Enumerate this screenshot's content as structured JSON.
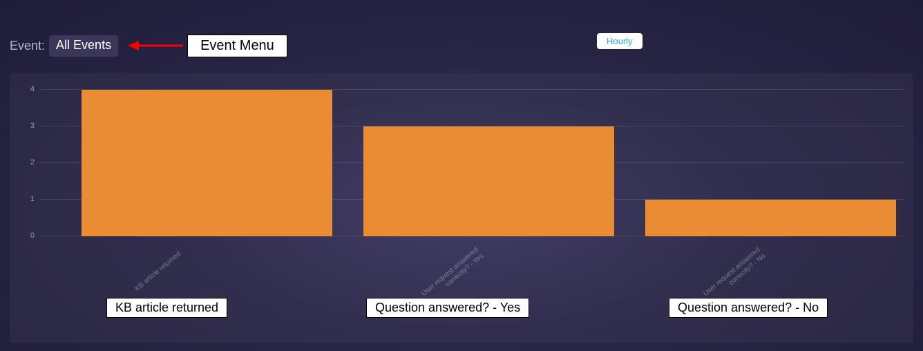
{
  "controls": {
    "event_label": "Event:",
    "event_selected": "All Events",
    "event_callout": "Event Menu",
    "hourly_label": "Hourly"
  },
  "chart_data": {
    "type": "bar",
    "categories": [
      "KB article returned",
      "User request answered\ncorrectly? - Yes",
      "User request answered\ncorrectly? - No"
    ],
    "values": [
      4,
      3,
      1
    ],
    "ylim": [
      0,
      4
    ],
    "yticks": [
      0,
      1,
      2,
      3,
      4
    ],
    "title": "",
    "xlabel": "",
    "ylabel": ""
  },
  "callouts": {
    "bars": [
      "KB article returned",
      "Question answered? - Yes",
      "Question answered? - No"
    ]
  },
  "colors": {
    "bar": "#e98c33",
    "arrow": "#ff0000",
    "hourly_text": "#29a6e6"
  }
}
